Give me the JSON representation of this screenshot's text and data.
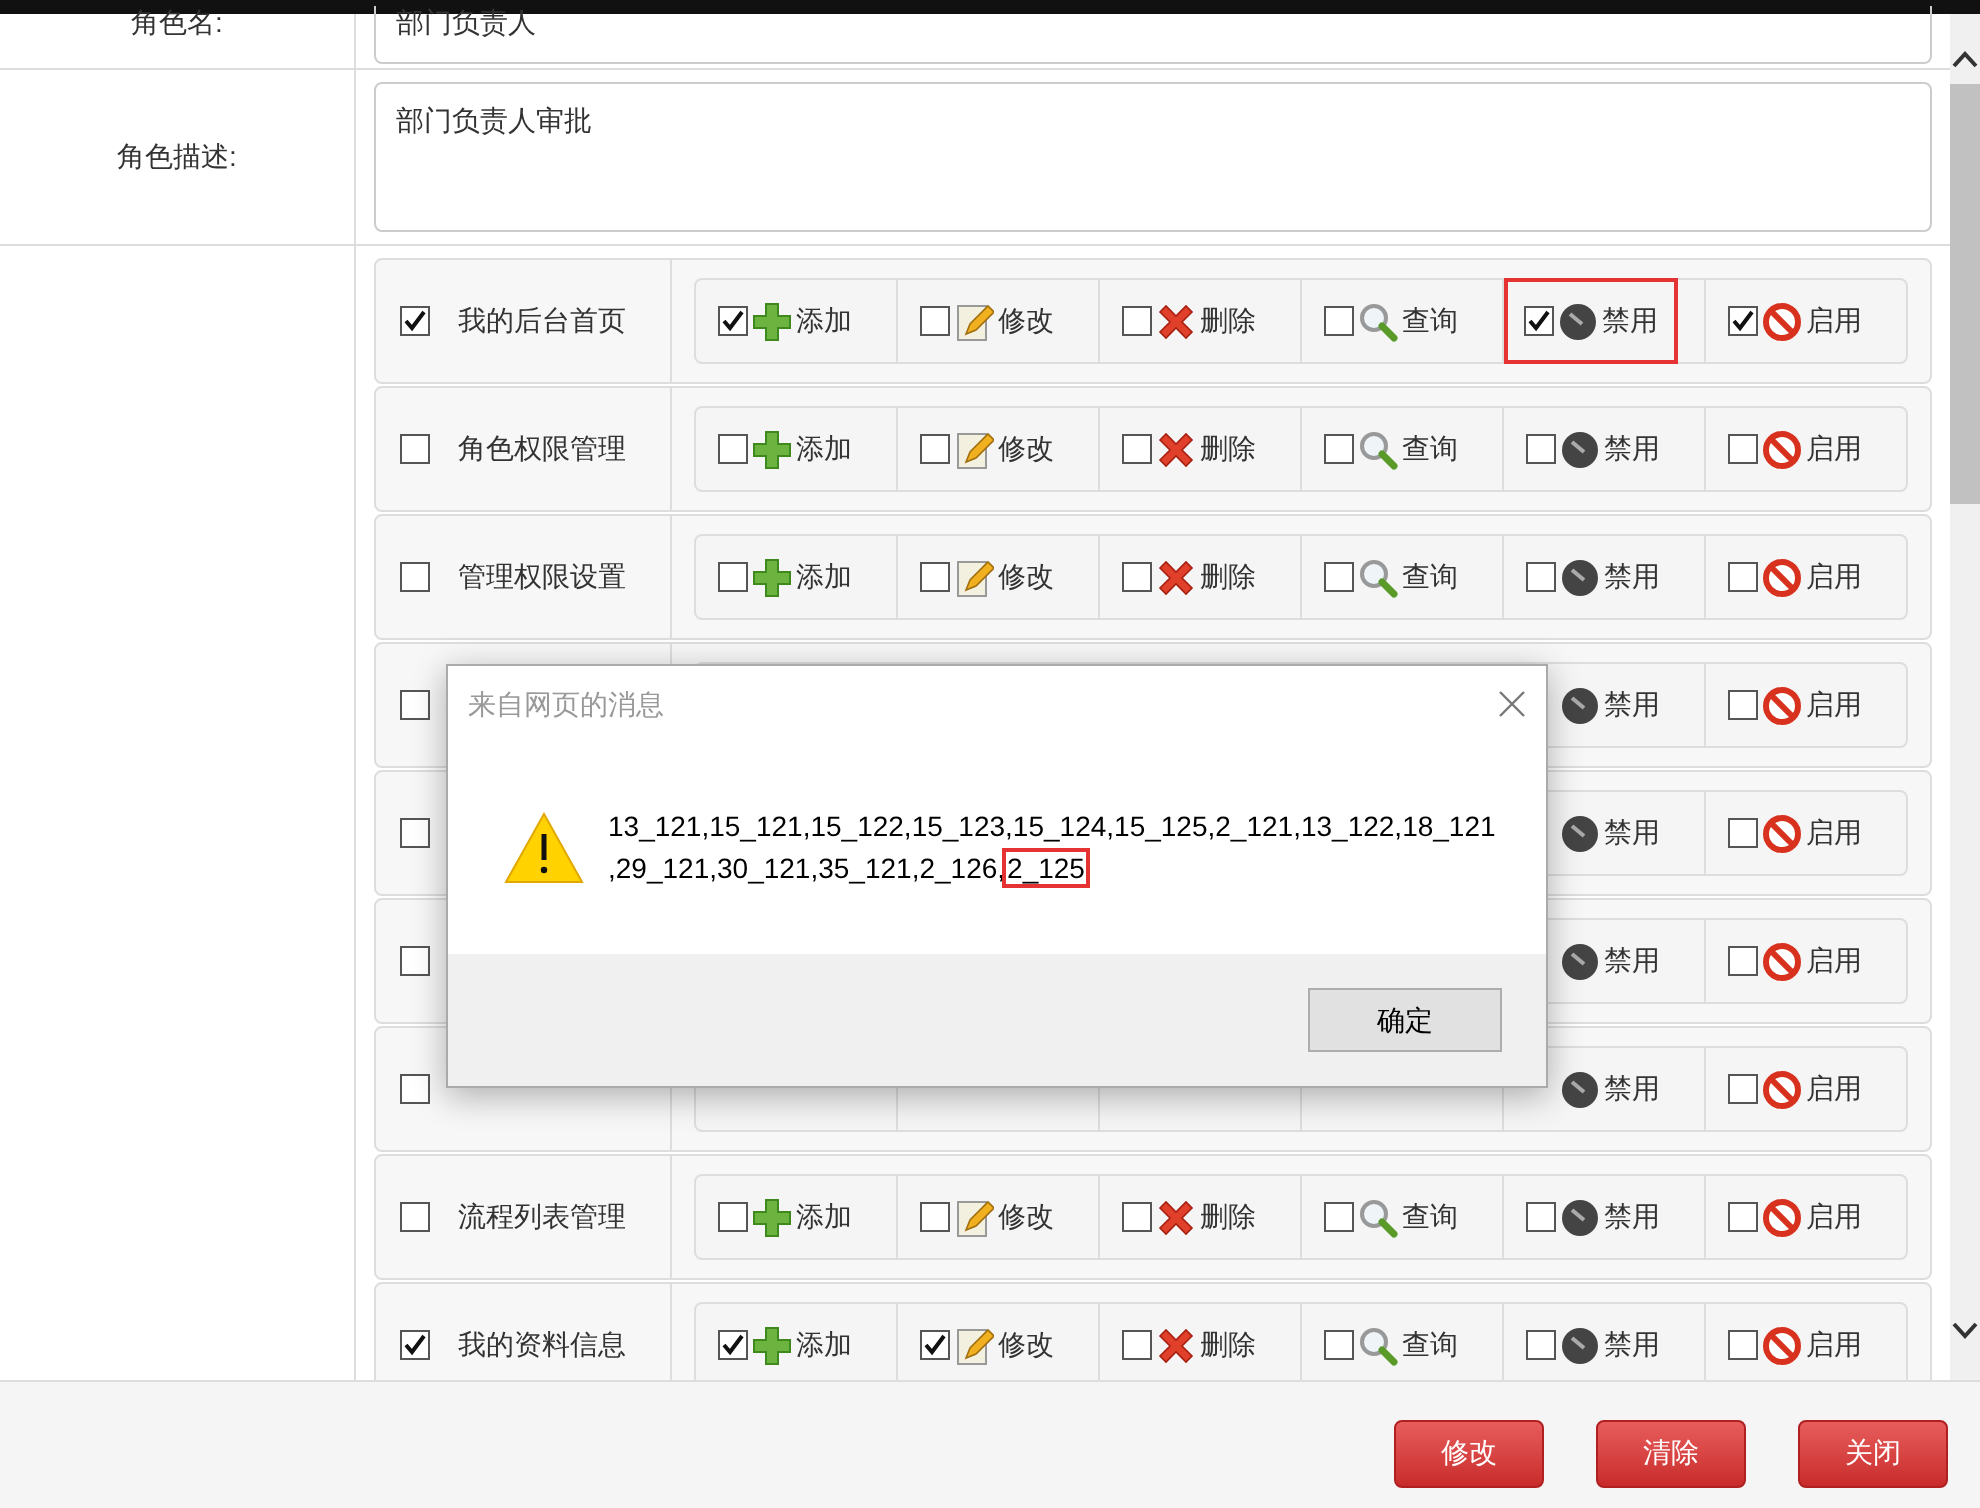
{
  "form": {
    "role_name": {
      "label": "角色名:",
      "value": "部门负责人"
    },
    "role_desc": {
      "label": "角色描述:",
      "value": "部门负责人审批"
    }
  },
  "permissions": [
    {
      "name": "我的后台首页",
      "checked": true,
      "perms": [
        {
          "kind": "add",
          "label": "添加",
          "checked": true
        },
        {
          "kind": "edit",
          "label": "修改",
          "checked": false
        },
        {
          "kind": "delete",
          "label": "删除",
          "checked": false
        },
        {
          "kind": "query",
          "label": "查询",
          "checked": false
        },
        {
          "kind": "disable",
          "label": "禁用",
          "checked": true,
          "highlighted": true
        },
        {
          "kind": "enable",
          "label": "启用",
          "checked": true
        }
      ]
    },
    {
      "name": "角色权限管理",
      "checked": false,
      "perms": [
        {
          "kind": "add",
          "label": "添加",
          "checked": false
        },
        {
          "kind": "edit",
          "label": "修改",
          "checked": false
        },
        {
          "kind": "delete",
          "label": "删除",
          "checked": false
        },
        {
          "kind": "query",
          "label": "查询",
          "checked": false
        },
        {
          "kind": "disable",
          "label": "禁用",
          "checked": false
        },
        {
          "kind": "enable",
          "label": "启用",
          "checked": false
        }
      ]
    },
    {
      "name": "管理权限设置",
      "checked": false,
      "perms": [
        {
          "kind": "add",
          "label": "添加",
          "checked": false
        },
        {
          "kind": "edit",
          "label": "修改",
          "checked": false
        },
        {
          "kind": "delete",
          "label": "删除",
          "checked": false
        },
        {
          "kind": "query",
          "label": "查询",
          "checked": false
        },
        {
          "kind": "disable",
          "label": "禁用",
          "checked": false
        },
        {
          "kind": "enable",
          "label": "启用",
          "checked": false
        }
      ]
    },
    {
      "checked": false,
      "perms": [
        {
          "kind": "disable",
          "label": "禁用"
        },
        {
          "kind": "enable",
          "label": "启用",
          "checked": false
        }
      ]
    },
    {
      "checked": false,
      "perms": [
        {
          "kind": "disable",
          "label": "禁用"
        },
        {
          "kind": "enable",
          "label": "启用",
          "checked": false
        }
      ]
    },
    {
      "checked": false,
      "perms": [
        {
          "kind": "disable",
          "label": "禁用"
        },
        {
          "kind": "enable",
          "label": "启用",
          "checked": false
        }
      ]
    },
    {
      "checked": false,
      "perms": [
        {
          "kind": "disable",
          "label": "禁用"
        },
        {
          "kind": "enable",
          "label": "启用",
          "checked": false
        }
      ]
    },
    {
      "name": "流程列表管理",
      "checked": false,
      "perms": [
        {
          "kind": "add",
          "label": "添加",
          "checked": false
        },
        {
          "kind": "edit",
          "label": "修改",
          "checked": false
        },
        {
          "kind": "delete",
          "label": "删除",
          "checked": false
        },
        {
          "kind": "query",
          "label": "查询",
          "checked": false
        },
        {
          "kind": "disable",
          "label": "禁用",
          "checked": false
        },
        {
          "kind": "enable",
          "label": "启用",
          "checked": false
        }
      ]
    },
    {
      "name": "我的资料信息",
      "checked": true,
      "perms": [
        {
          "kind": "add",
          "label": "添加",
          "checked": true
        },
        {
          "kind": "edit",
          "label": "修改",
          "checked": true
        },
        {
          "kind": "delete",
          "label": "删除",
          "checked": false
        },
        {
          "kind": "query",
          "label": "查询",
          "checked": false
        },
        {
          "kind": "disable",
          "label": "禁用",
          "checked": false
        },
        {
          "kind": "enable",
          "label": "启用",
          "checked": false
        }
      ]
    }
  ],
  "buttons": [
    "修改",
    "清除",
    "关闭"
  ],
  "dialog": {
    "title": "来自网页的消息",
    "message_lines": [
      "13_121,15_121,15_122,15_123,15_124,15_125,2_121,13_122,18_121",
      ",29_121,30_121,35_121,2_126,"
    ],
    "highlight": "2_125",
    "ok_button": "确定"
  }
}
